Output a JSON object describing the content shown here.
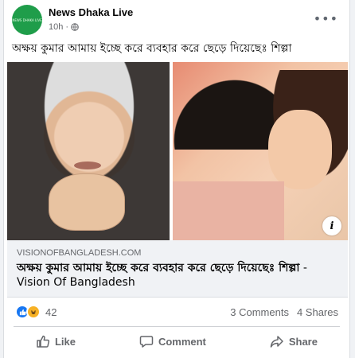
{
  "post": {
    "page_name": "News Dhaka Live",
    "avatar_text": "NEWS DHAKA LIVE",
    "time": "10h",
    "time_separator": "·",
    "more": "•••",
    "text": "অক্ষয় কুমার আমায় ইচ্ছে করে ব্যবহার করে ছেড়ে দিয়েছেঃ শিল্পা"
  },
  "link": {
    "domain": "VISIONOFBANGLADESH.COM",
    "title": "অক্ষয় কুমার আমায় ইচ্ছে করে ব্যবহার করে ছেড়ে দিয়েছেঃ শিল্পা",
    "site_suffix": " - Vision Of Bangladesh",
    "info": "i"
  },
  "stats": {
    "reaction_count": "42",
    "comments": "3 Comments",
    "shares": "4 Shares"
  },
  "actions": {
    "like": "Like",
    "comment": "Comment",
    "share": "Share"
  },
  "icons": [
    "globe-icon",
    "more-icon",
    "info-icon",
    "like-reaction-icon",
    "haha-reaction-icon",
    "thumb-up-icon",
    "comment-icon",
    "share-icon"
  ],
  "colors": {
    "accent": "#1877f2",
    "muted": "#65676b",
    "link_bg": "#f0f2f5"
  }
}
